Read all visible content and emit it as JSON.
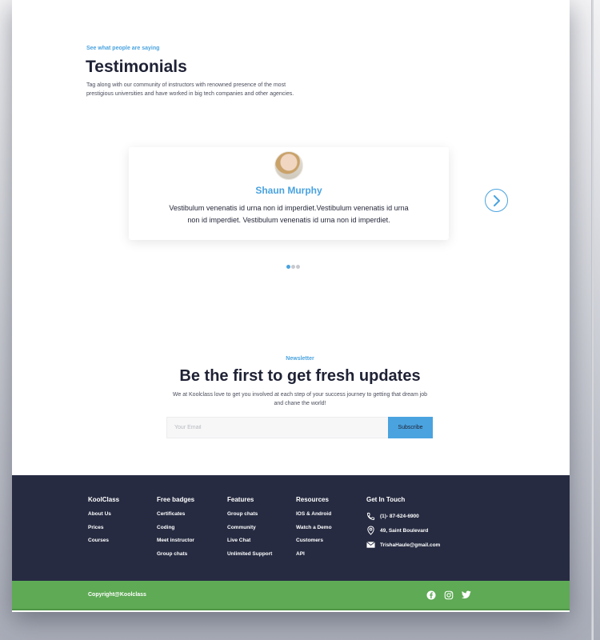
{
  "testimonials": {
    "eyebrow": "See what people are saying",
    "title": "Testimonials",
    "description": "Tag along with our community of instructors with renowned presence of the most prestigious universities and have worked in big tech companies and other agencies.",
    "card": {
      "name": "Shaun Murphy",
      "text": "Vestibulum venenatis id urna non id imperdiet.Vestibulum venenatis id urna non id imperdiet. Vestibulum venenatis id urna non id imperdiet."
    },
    "carousel": {
      "active_index": 0,
      "count": 3
    }
  },
  "newsletter": {
    "eyebrow": "Newsletter",
    "title": "Be the first to get fresh updates",
    "description": "We at Koolclass love to get you involved at each step of your success journey to getting that dream job and chane the world!",
    "email_placeholder": "Your Email",
    "subscribe_label": "Subscribe"
  },
  "footer": {
    "columns": [
      {
        "title": "KoolClass",
        "links": [
          "About Us",
          "Prices",
          "Courses"
        ]
      },
      {
        "title": "Free badges",
        "links": [
          "Certificates",
          "Coding",
          "Meet instructor",
          "Group chats"
        ]
      },
      {
        "title": "Features",
        "links": [
          "Group chats",
          "Community",
          "Live Chat",
          "Unlimited Support"
        ]
      },
      {
        "title": "Resources",
        "links": [
          "IOS & Android",
          "Watch a Demo",
          "Customers",
          "API"
        ]
      }
    ],
    "contact": {
      "title": "Get In Touch",
      "phone": "(1)- 87-624-6900",
      "address": "49, Saint Boulevard",
      "email": "TrishaHaule@gmail.com"
    },
    "copyright": "Copyright@Koolclass",
    "socials": [
      "facebook-icon",
      "instagram-icon",
      "twitter-icon"
    ]
  },
  "colors": {
    "accent": "#4aa3df",
    "dark": "#262b41",
    "green": "#5faa55"
  }
}
